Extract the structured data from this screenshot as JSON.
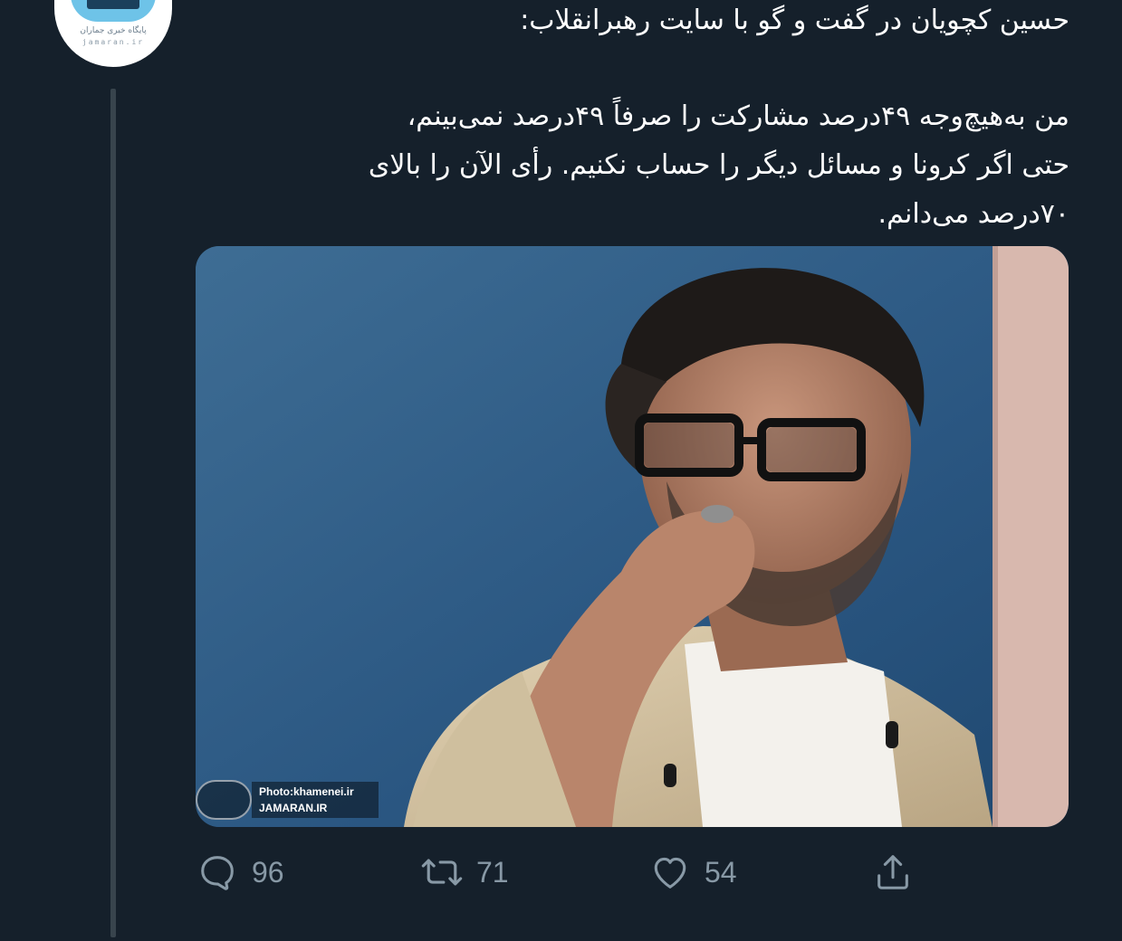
{
  "account": {
    "avatar_name": "jamaran-logo",
    "avatar_line1": "پایگاه خبری جماران",
    "avatar_line2": "jamaran.ir"
  },
  "tweet": {
    "lines": [
      "حسین کچویان در گفت و گو با سایت رهبرانقلاب:",
      "",
      "من به‌هیچ‌وجه ۴۹درصد مشارکت را صرفاً ۴۹درصد نمی‌بینم،",
      "حتی اگر کرونا و مسائل دیگر را حساب نکنیم. رأی الآن را بالای",
      "۷۰درصد می‌دانم."
    ]
  },
  "media": {
    "watermark_line1": "Photo:khamenei.ir",
    "watermark_line2": "JAMARAN.IR"
  },
  "actions": {
    "reply_count": "96",
    "retweet_count": "71",
    "like_count": "54"
  },
  "colors": {
    "background": "#15202b",
    "text": "#ffffff",
    "muted": "#8899a6",
    "thread_line": "#38444d"
  }
}
